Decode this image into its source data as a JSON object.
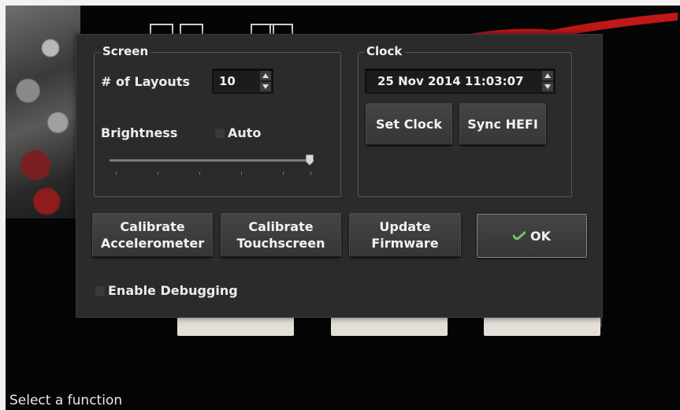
{
  "dialog": {
    "screen_group": {
      "title": "Screen",
      "layouts_label": "# of Layouts",
      "layouts_value": "10",
      "brightness_label": "Brightness",
      "auto_label": "Auto",
      "auto_checked": false,
      "brightness_level": 1.0
    },
    "clock_group": {
      "title": "Clock",
      "datetime_value": "25 Nov 2014 11:03:07",
      "set_clock_label": "Set Clock",
      "sync_hefi_label": "Sync HEFI"
    },
    "buttons": {
      "calibrate_accelerometer": [
        "Calibrate",
        "Accelerometer"
      ],
      "calibrate_touchscreen": [
        "Calibrate",
        "Touchscreen"
      ],
      "update_firmware": [
        "Update",
        "Firmware"
      ],
      "ok": "OK"
    },
    "enable_debugging_label": "Enable Debugging",
    "enable_debugging_checked": false
  },
  "status_text": "Select a function",
  "colors": {
    "dialog_bg": "#2b2b2b",
    "button_bg": "#3f3f3f",
    "text": "#f0f0f0",
    "ok_icon": "#7cc26a",
    "swoosh": "#c01818"
  },
  "icons": [
    "ok-check-icon",
    "spin-up-arrow-icon",
    "spin-down-arrow-icon",
    "slider-handle-icon"
  ]
}
